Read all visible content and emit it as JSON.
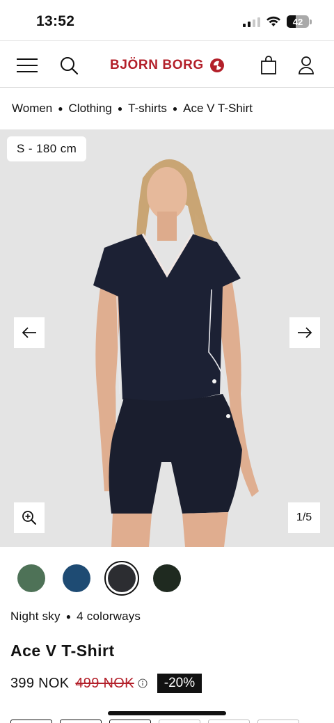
{
  "status_bar": {
    "time": "13:52",
    "battery": "42",
    "battery_level": 0.42
  },
  "header": {
    "brand": "BJÖRN BORG",
    "menu_icon": "hamburger-icon",
    "search_icon": "search-icon",
    "cart_icon": "shopping-bag-icon",
    "account_icon": "user-icon",
    "brand_color": "#b3202a"
  },
  "breadcrumb": [
    "Women",
    "Clothing",
    "T-shirts",
    "Ace V T-Shirt"
  ],
  "gallery": {
    "size_label": "S - 180 cm",
    "counter": "1/5",
    "prev_icon": "arrow-left-icon",
    "next_icon": "arrow-right-icon",
    "zoom_icon": "zoom-in-icon"
  },
  "swatches": [
    {
      "color": "#4e7257",
      "selected": false
    },
    {
      "color": "#1e4b73",
      "selected": false
    },
    {
      "color": "#2c2d31",
      "selected": true
    },
    {
      "color": "#1f2a20",
      "selected": false
    }
  ],
  "color_info": {
    "color_name": "Night sky",
    "colorways": "4 colorways"
  },
  "product": {
    "title": "Ace V T-Shirt",
    "price": "399 NOK",
    "old_price": "499 NOK",
    "discount": "-20%"
  }
}
